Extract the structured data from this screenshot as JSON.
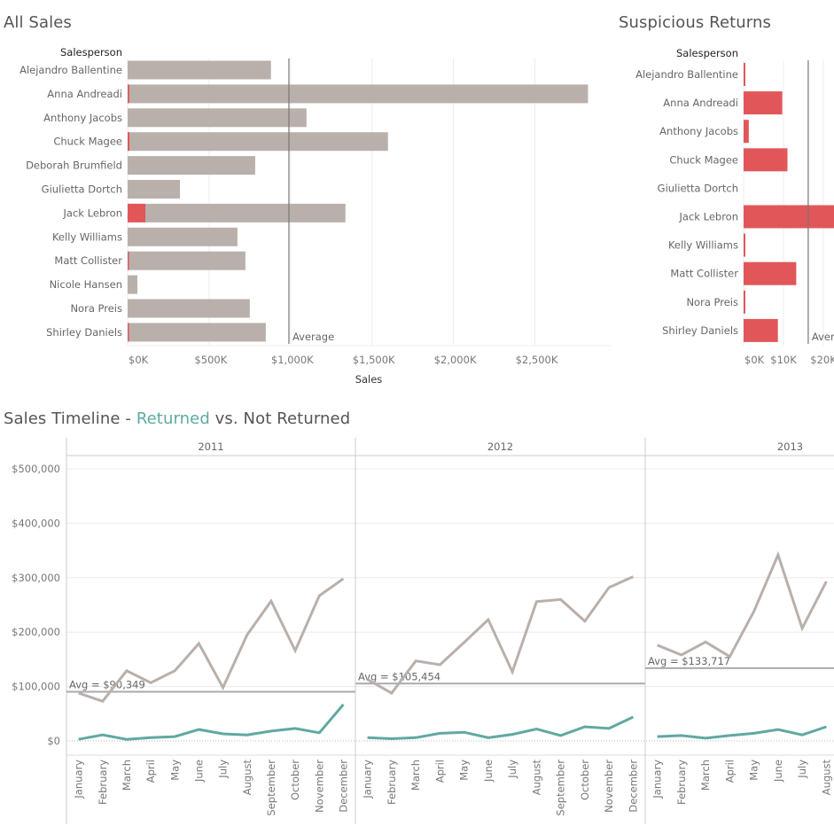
{
  "dashboard": {
    "titles": {
      "all_sales": "All Sales",
      "suspicious_returns": "Suspicious Returns",
      "timeline_prefix": "Sales Timeline - ",
      "timeline_highlight": "Returned",
      "timeline_suffix": " vs. Not Returned"
    },
    "colors": {
      "not_returned": "#b9b0ab",
      "returned_red": "#e15759",
      "returned_teal": "#5fa9a1",
      "average_line": "#8a8a8a",
      "grid": "#ececec"
    }
  },
  "chart_data": [
    {
      "id": "all_sales",
      "type": "bar",
      "title": "All Sales",
      "row_header": "Salesperson",
      "xlabel": "Sales",
      "xlim": [
        0,
        2850
      ],
      "x_unit": "K",
      "x_ticks": [
        "$0K",
        "$500K",
        "$1,000K",
        "$1,500K",
        "$2,000K",
        "$2,500K"
      ],
      "x_tick_values": [
        0,
        500,
        1000,
        1500,
        2000,
        2500
      ],
      "reference_line": {
        "label": "Average",
        "value": 990
      },
      "categories": [
        "Alejandro Ballentine",
        "Anna Andreadi",
        "Anthony Jacobs",
        "Chuck Magee",
        "Deborah Brumfield",
        "Giulietta Dortch",
        "Jack Lebron",
        "Kelly Williams",
        "Matt Collister",
        "Nicole Hansen",
        "Nora Preis",
        "Shirley Daniels"
      ],
      "series": [
        {
          "name": "Not Returned",
          "values": [
            880,
            2826,
            1098,
            1598,
            783,
            321,
            1337,
            674,
            723,
            60,
            750,
            848
          ]
        },
        {
          "name": "Returned",
          "values": [
            0,
            10,
            0,
            11,
            0,
            0,
            109,
            0,
            7,
            0,
            0,
            8
          ]
        }
      ]
    },
    {
      "id": "suspicious_returns",
      "type": "bar",
      "title": "Suspicious Returns",
      "row_header": "Salesperson",
      "xlim": [
        0,
        22.5
      ],
      "x_unit": "K",
      "x_ticks": [
        "$0K",
        "$10K",
        "$20K"
      ],
      "x_tick_values": [
        0,
        10,
        20
      ],
      "reference_line": {
        "label": "Average",
        "value": 16.2
      },
      "categories": [
        "Alejandro Ballentine",
        "Anna Andreadi",
        "Anthony Jacobs",
        "Chuck Magee",
        "Giulietta Dortch",
        "Jack Lebron",
        "Kelly Williams",
        "Matt Collister",
        "Nora Preis",
        "Shirley Daniels"
      ],
      "values": [
        0.4,
        9.7,
        1.3,
        11.0,
        0,
        25.0,
        0.4,
        13.2,
        0.4,
        8.6
      ]
    },
    {
      "id": "sales_timeline",
      "type": "line",
      "title": "Sales Timeline - Returned vs. Not Returned",
      "ylim": [
        0,
        500000
      ],
      "y_ticks": [
        "$0",
        "$100,000",
        "$200,000",
        "$300,000",
        "$400,000",
        "$500,000"
      ],
      "y_tick_values": [
        0,
        100000,
        200000,
        300000,
        400000,
        500000
      ],
      "months": [
        "January",
        "February",
        "March",
        "April",
        "May",
        "June",
        "July",
        "August",
        "September",
        "October",
        "November",
        "December"
      ],
      "panels": [
        {
          "year": "2011",
          "avg_label": "Avg = $90,349",
          "avg_value": 90349,
          "series": [
            {
              "name": "Not Returned",
              "values": [
                88000,
                73000,
                129000,
                107000,
                129000,
                179000,
                98000,
                195000,
                257000,
                166000,
                267000,
                298000
              ]
            },
            {
              "name": "Returned",
              "values": [
                3000,
                11000,
                3000,
                6000,
                8000,
                21000,
                13000,
                11000,
                18000,
                23000,
                15000,
                67000
              ]
            }
          ]
        },
        {
          "year": "2012",
          "avg_label": "Avg = $105,454",
          "avg_value": 105454,
          "series": [
            {
              "name": "Not Returned",
              "values": [
                113000,
                88000,
                147000,
                140000,
                181000,
                223000,
                127000,
                256000,
                260000,
                220000,
                282000,
                302000
              ]
            },
            {
              "name": "Returned",
              "values": [
                6000,
                4000,
                6000,
                14000,
                16000,
                6000,
                12000,
                22000,
                10000,
                26000,
                23000,
                44000
              ]
            }
          ]
        },
        {
          "year": "2013",
          "avg_label": "Avg = $133,717",
          "avg_value": 133717,
          "visible_months": 8,
          "series": [
            {
              "name": "Not Returned",
              "values": [
                176000,
                158000,
                182000,
                155000,
                238000,
                342000,
                207000,
                293000
              ]
            },
            {
              "name": "Returned",
              "values": [
                8000,
                10000,
                5000,
                10000,
                14000,
                21000,
                11000,
                26000
              ]
            }
          ]
        }
      ]
    }
  ]
}
